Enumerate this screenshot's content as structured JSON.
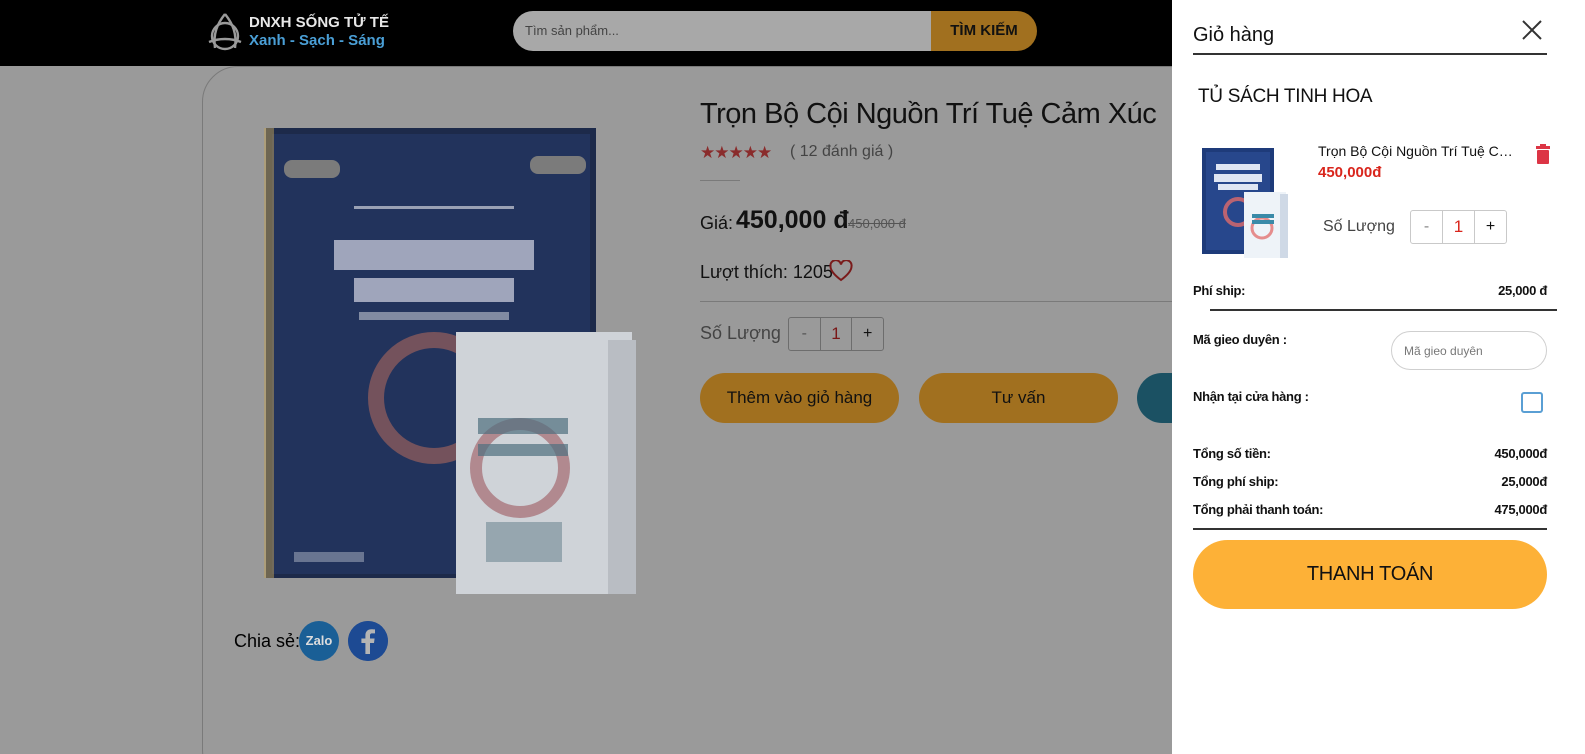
{
  "header": {
    "logo_line1": "DNXH SỐNG TỬ TẾ",
    "logo_line2": "Xanh - Sạch - Sáng",
    "search_placeholder": "Tìm sản phẩm...",
    "search_button": "TÌM KIẾM"
  },
  "product": {
    "title": "Trọn Bộ Cội Nguồn Trí Tuệ Cảm Xúc",
    "stars": "★★★★★",
    "rating_value": 5,
    "review_count": "( 12 đánh giá )",
    "price_label": "Giá:",
    "price": "450,000 đ",
    "old_price": "450,000 đ",
    "likes": "Lượt thích: 1205",
    "quantity_label": "Số Lượng",
    "qty_minus": "-",
    "quantity": "1",
    "qty_plus": "+",
    "add_to_cart": "Thêm vào giỏ hàng",
    "consult": "Tư vấn",
    "share_label": "Chia sẻ:",
    "zalo": "Zalo"
  },
  "cart": {
    "title": "Giỏ hàng",
    "store_name": "TỦ SÁCH TINH HOA",
    "item_name": "Trọn Bộ Cội Nguồn Trí Tuệ Cảm Xúc",
    "item_price": "450,000đ",
    "quantity_label": "Số Lượng",
    "qty_minus": "-",
    "quantity": "1",
    "qty_plus": "+",
    "shipping_label": "Phí ship:",
    "shipping_value": "25,000 đ",
    "coupon_label": "Mã gieo duyên :",
    "coupon_placeholder": "Mã gieo duyên",
    "pickup_label": "Nhận tại cửa hàng :",
    "subtotal_label": "Tổng số tiền:",
    "subtotal_value": "450,000đ",
    "total_shipping_label": "Tổng phí ship:",
    "total_shipping_value": "25,000đ",
    "grand_total_label": "Tổng phải thanh toán:",
    "grand_total_value": "475,000đ",
    "checkout_button": "THANH TOÁN"
  },
  "colors": {
    "accent": "#fdb137",
    "price_red": "#d9251c",
    "overlay_gray": "#9a9a9a"
  }
}
